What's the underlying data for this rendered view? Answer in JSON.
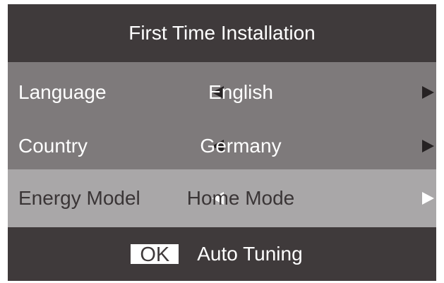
{
  "header": {
    "title": "First Time Installation"
  },
  "menu": [
    {
      "label": "Language",
      "value": "English"
    },
    {
      "label": "Country",
      "value": "Germany"
    },
    {
      "label": "Energy Model",
      "value": "Home Mode"
    }
  ],
  "footer": {
    "ok_label": "OK",
    "action_text": "Auto Tuning"
  },
  "icons": {
    "left": "arrow-left-icon",
    "right": "arrow-right-icon"
  },
  "colors": {
    "panel": "#3f3a3b",
    "row": "#7e7a7b",
    "selected_row": "#a9a7a8",
    "text": "#ffffff"
  },
  "selected_index": 2
}
